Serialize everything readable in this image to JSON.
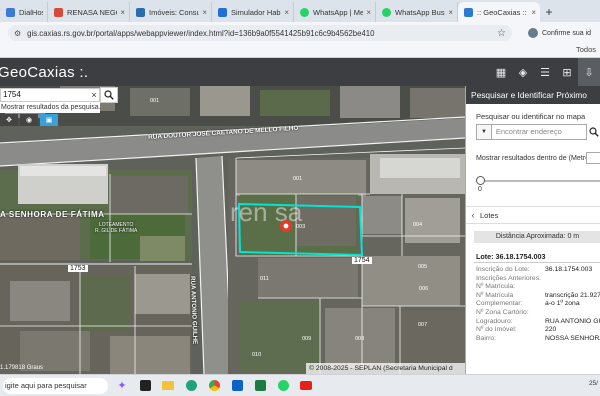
{
  "browser": {
    "tabs": [
      {
        "label": "DialHost W",
        "color": "#3a7bd5"
      },
      {
        "label": "RENASA NEGÓCI",
        "color": "#d54a3a"
      },
      {
        "label": "Imóveis: Consult",
        "color": "#2b6cb0"
      },
      {
        "label": "Simulador Habit",
        "color": "#1f6fd6"
      },
      {
        "label": "WhatsApp | Men",
        "color": "#25d366"
      },
      {
        "label": "WhatsApp Busi",
        "color": "#25d366"
      },
      {
        "label": ":: GeoCaxias ::",
        "color": "#2a7ad1"
      }
    ],
    "new_tab": "+",
    "url": "gis.caxias.rs.gov.br/portal/apps/webappviewer/index.html?id=136b9a0f5541425b91c6c9b4562be410",
    "profile_label": "Confirme sua id",
    "bookmarks_more": "Todos"
  },
  "app": {
    "title": "GeoCaxias :.",
    "tools": [
      "grid-icon",
      "layers-icon",
      "list-icon",
      "legend-icon",
      "download-icon"
    ]
  },
  "map": {
    "search_value": "1754",
    "search_clear": "×",
    "search_hint": "Mostrar resultados da pesquisa...",
    "street_name_1": "RUA DOUTOR JOSÉ CAETANO DE MELLO FILHO",
    "street_name_2": "RUA ANTONIO GUILHE",
    "place_label": "A SENHORA DE FÁTIMA",
    "place_label_2": "LOTEAMENTO\nR. GIL DE FÁTIMA",
    "lot_numbers": [
      "1753",
      "1754"
    ],
    "parcel_labels": [
      "001",
      "003",
      "004",
      "005",
      "006",
      "007",
      "008",
      "009",
      "010",
      "011",
      "001",
      "002"
    ],
    "watermark": "ren sa",
    "credits": "© 2008-2025 - SEPLAN (Secretaria Municipal d",
    "scale_text": "1.179818 Graus"
  },
  "panel": {
    "title": "Pesquisar e Identificar Próximo",
    "find_label": "Pesquisar ou identificar no mapa",
    "find_placeholder": "Encontrar endereço",
    "distance_label": "Mostrar resultados dentro de (Metros)",
    "slider_min": "0",
    "slider_value": 0,
    "results_title": "Lotes",
    "approx_distance": "Distância Aproximada: 0 m",
    "lot_heading": "Lote: 36.18.1754.003",
    "attributes": [
      {
        "k": "Inscrição do Lote:",
        "v": "36.18.1754.003"
      },
      {
        "k": "Inscrições Anteriores:",
        "v": ""
      },
      {
        "k": "Nº Matrícula:",
        "v": ""
      },
      {
        "k": "Nº Matrícula",
        "v": "transcrição 21.927"
      },
      {
        "k": "Complementar:",
        "v": "a-o 1º zona"
      },
      {
        "k": "Nº Zona Cartório:",
        "v": ""
      },
      {
        "k": "Logradouro:",
        "v": "RUA ANTONIO GU"
      },
      {
        "k": "Nº do Imóvel:",
        "v": "220"
      },
      {
        "k": "Bairro:",
        "v": "NOSSA SENHORA"
      }
    ]
  },
  "taskbar": {
    "search_text": "igite aqui para pesquisar",
    "time_partial": "25/"
  },
  "colors": {
    "header": "#3c3e42",
    "highlight": "#00e5d4",
    "pin": "#e23b2e"
  }
}
